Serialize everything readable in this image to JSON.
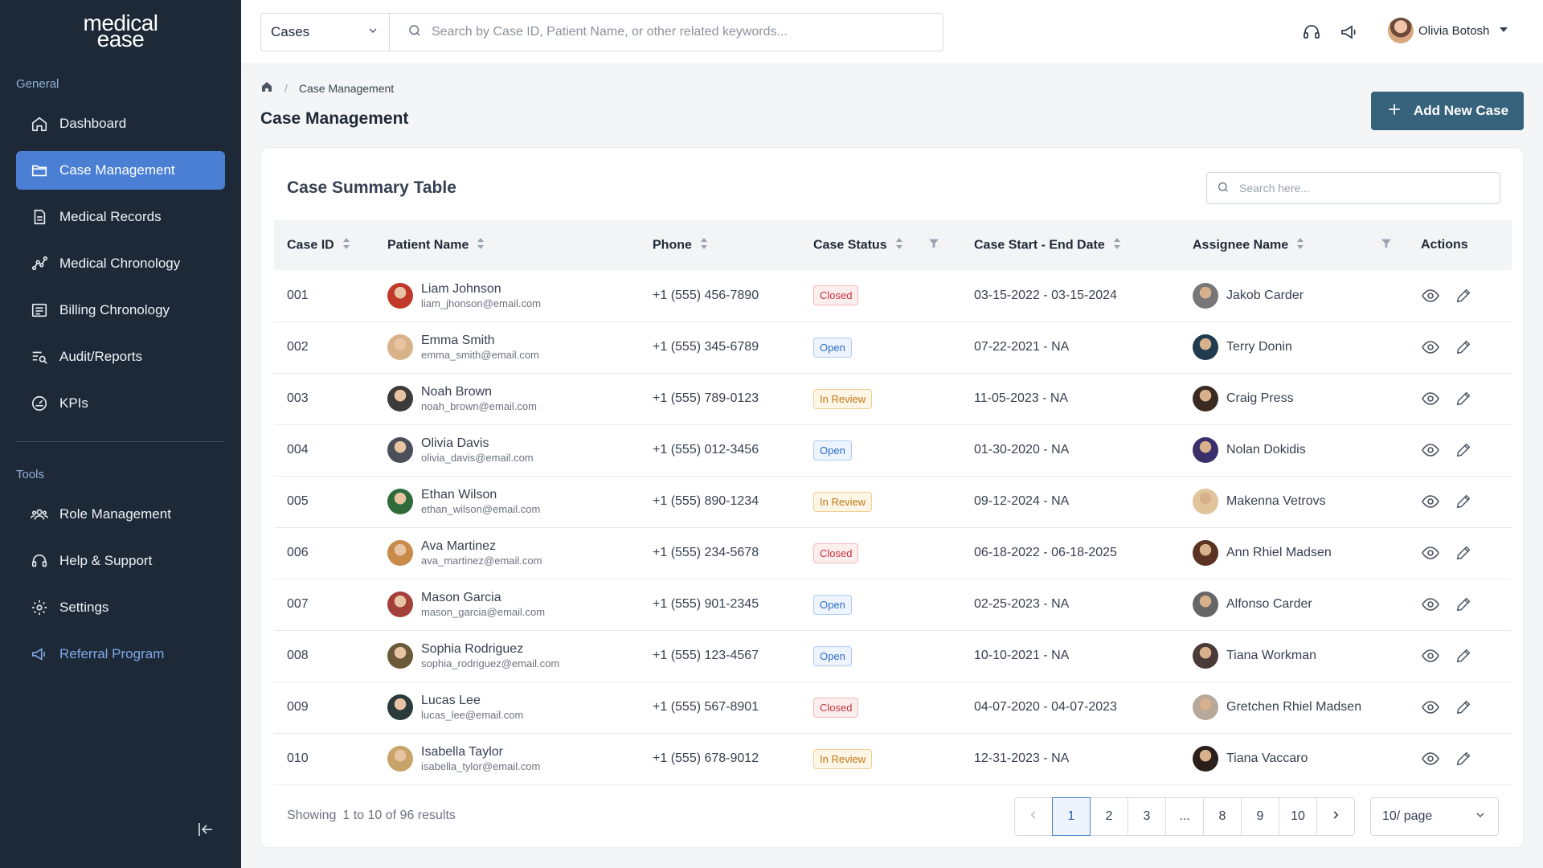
{
  "brand": {
    "line1": "medical",
    "line2": "ease"
  },
  "sidebar": {
    "general_label": "General",
    "tools_label": "Tools",
    "items": [
      {
        "label": "Dashboard",
        "icon": "home-icon"
      },
      {
        "label": "Case Management",
        "icon": "folder-icon",
        "active": true
      },
      {
        "label": "Medical Records",
        "icon": "document-icon"
      },
      {
        "label": "Medical Chronology",
        "icon": "chart-line-icon"
      },
      {
        "label": "Billing Chronology",
        "icon": "receipt-icon"
      },
      {
        "label": "Audit/Reports",
        "icon": "report-search-icon"
      },
      {
        "label": "KPIs",
        "icon": "gauge-icon"
      }
    ],
    "tools": [
      {
        "label": "Role Management",
        "icon": "users-icon"
      },
      {
        "label": "Help & Support",
        "icon": "headset-icon"
      },
      {
        "label": "Settings",
        "icon": "gear-icon"
      },
      {
        "label": "Referral Program",
        "icon": "megaphone-icon"
      }
    ]
  },
  "topbar": {
    "scope": "Cases",
    "search_placeholder": "Search by Case ID, Patient Name, or other related keywords...",
    "user_name": "Olivia Botosh"
  },
  "page": {
    "breadcrumb": "Case Management",
    "title": "Case Management",
    "add_button": "Add New Case"
  },
  "table": {
    "title": "Case Summary Table",
    "search_placeholder": "Search here...",
    "columns": [
      "Case ID",
      "Patient Name",
      "Phone",
      "Case Status",
      "Case Start - End Date",
      "Assignee Name",
      "Actions"
    ],
    "rows": [
      {
        "id": "001",
        "name": "Liam Johnson",
        "email": "liam_jhonson@email.com",
        "phone": "+1 (555) 456-7890",
        "status": "Closed",
        "dates": "03-15-2022 - 03-15-2024",
        "assignee": "Jakob Carder"
      },
      {
        "id": "002",
        "name": "Emma Smith",
        "email": "emma_smith@email.com",
        "phone": "+1 (555) 345-6789",
        "status": "Open",
        "dates": "07-22-2021 - NA",
        "assignee": "Terry Donin"
      },
      {
        "id": "003",
        "name": "Noah Brown",
        "email": "noah_brown@email.com",
        "phone": "+1 (555) 789-0123",
        "status": "In Review",
        "dates": "11-05-2023 - NA",
        "assignee": "Craig Press"
      },
      {
        "id": "004",
        "name": "Olivia Davis",
        "email": "olivia_davis@email.com",
        "phone": "+1 (555) 012-3456",
        "status": "Open",
        "dates": "01-30-2020 - NA",
        "assignee": "Nolan Dokidis"
      },
      {
        "id": "005",
        "name": "Ethan Wilson",
        "email": "ethan_wilson@email.com",
        "phone": "+1 (555) 890-1234",
        "status": "In Review",
        "dates": "09-12-2024 - NA",
        "assignee": "Makenna Vetrovs"
      },
      {
        "id": "006",
        "name": "Ava Martinez",
        "email": "ava_martinez@email.com",
        "phone": "+1 (555) 234-5678",
        "status": "Closed",
        "dates": "06-18-2022 - 06-18-2025",
        "assignee": "Ann Rhiel Madsen"
      },
      {
        "id": "007",
        "name": "Mason Garcia",
        "email": "mason_garcia@email.com",
        "phone": "+1 (555) 901-2345",
        "status": "Open",
        "dates": "02-25-2023 - NA",
        "assignee": "Alfonso Carder"
      },
      {
        "id": "008",
        "name": "Sophia Rodriguez",
        "email": "sophia_rodriguez@email.com",
        "phone": "+1 (555) 123-4567",
        "status": "Open",
        "dates": "10-10-2021 - NA",
        "assignee": "Tiana Workman"
      },
      {
        "id": "009",
        "name": "Lucas Lee",
        "email": "lucas_lee@email.com",
        "phone": "+1 (555) 567-8901",
        "status": "Closed",
        "dates": "04-07-2020 - 04-07-2023",
        "assignee": "Gretchen Rhiel Madsen"
      },
      {
        "id": "010",
        "name": "Isabella Taylor",
        "email": "isabella_tylor@email.com",
        "phone": "+1 (555) 678-9012",
        "status": "In Review",
        "dates": "12-31-2023 - NA",
        "assignee": "Tiana Vaccaro"
      }
    ]
  },
  "footer": {
    "showing_label": "Showing",
    "showing_range": "1 to 10 of 96 results",
    "pages": [
      "1",
      "2",
      "3",
      "...",
      "8",
      "9",
      "10"
    ],
    "current_page": "1",
    "per_page": "10/ page"
  },
  "colors": {
    "sidebar_bg": "#1e2938",
    "active_nav": "#4a7fd4",
    "primary_button": "#36627c",
    "closed": "#c2333b",
    "open": "#2d6cc7",
    "in_review": "#c07a12"
  }
}
